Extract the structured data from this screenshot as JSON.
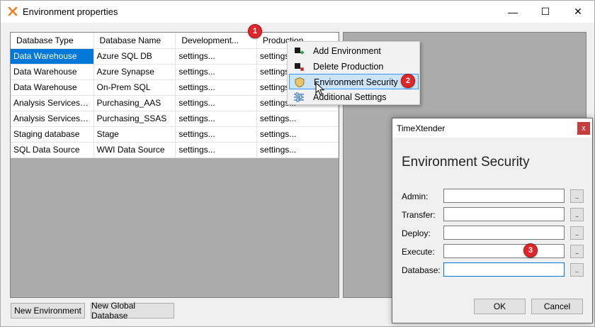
{
  "window": {
    "title": "Environment properties",
    "controls": {
      "minimize": "—",
      "maximize": "☐",
      "close": "✕"
    }
  },
  "grid": {
    "columns": [
      "Database Type",
      "Database Name",
      "Development...",
      "Production"
    ],
    "rows": [
      [
        "Data Warehouse",
        "Azure SQL DB",
        "settings...",
        "settings..."
      ],
      [
        "Data Warehouse",
        "Azure Synapse",
        "settings...",
        "settings..."
      ],
      [
        "Data Warehouse",
        "On-Prem SQL",
        "settings...",
        "settings..."
      ],
      [
        "Analysis Services Ta...",
        "Purchasing_AAS",
        "settings...",
        "settings..."
      ],
      [
        "Analysis Services Ta...",
        "Purchasing_SSAS",
        "settings...",
        "settings..."
      ],
      [
        "Staging database",
        "Stage",
        "settings...",
        "settings..."
      ],
      [
        "SQL Data Source",
        "WWI Data Source",
        "settings...",
        "settings..."
      ]
    ],
    "selected_row": 0
  },
  "buttons": {
    "new_environment": "New Environment",
    "new_global_database": "New Global Database"
  },
  "context_menu": {
    "items": [
      {
        "label": "Add Environment",
        "icon": "add-environment-icon"
      },
      {
        "label": "Delete Production",
        "icon": "delete-production-icon"
      },
      {
        "label": "Environment Security",
        "icon": "shield-icon",
        "highlighted": true
      },
      {
        "label": "Additional Settings",
        "icon": "settings-sliders-icon"
      }
    ]
  },
  "badges": [
    "1",
    "2",
    "3"
  ],
  "dialog": {
    "title": "TimeXtender",
    "close": "x",
    "heading": "Environment Security",
    "fields": [
      {
        "label": "Admin:",
        "value": ""
      },
      {
        "label": "Transfer:",
        "value": ""
      },
      {
        "label": "Deploy:",
        "value": ""
      },
      {
        "label": "Execute:",
        "value": ""
      },
      {
        "label": "Database:",
        "value": ""
      }
    ],
    "browse_label": "..",
    "ok": "OK",
    "cancel": "Cancel"
  },
  "colors": {
    "selection": "#0078d7",
    "badge": "#e0262a",
    "menu_highlight": "#cce4f7",
    "app_icon": "#f07c1b"
  }
}
